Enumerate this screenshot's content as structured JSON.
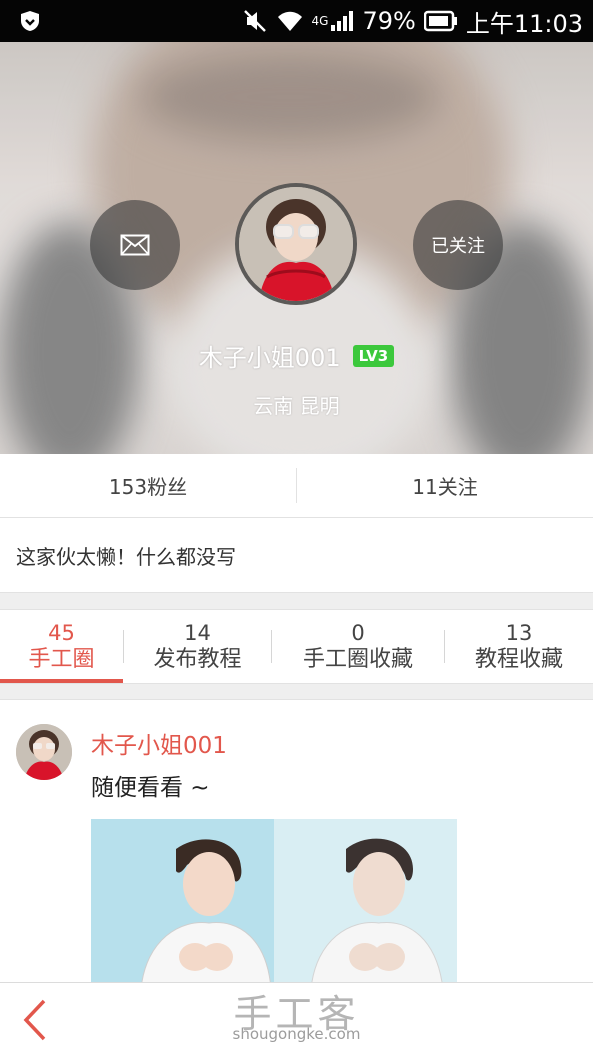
{
  "status_bar": {
    "battery_percent": "79%",
    "network": "4G",
    "time": "上午11:03"
  },
  "profile": {
    "username": "木子小姐001",
    "level_badge": "LV3",
    "location": "云南 昆明",
    "follow_label": "已关注",
    "message_icon": "envelope-icon"
  },
  "stats": {
    "fans": "153粉丝",
    "following": "11关注"
  },
  "bio": "这家伙太懒！什么都没写",
  "tabs": [
    {
      "count": "45",
      "label": "手工圈",
      "active": true
    },
    {
      "count": "14",
      "label": "发布教程",
      "active": false
    },
    {
      "count": "0",
      "label": "手工圈收藏",
      "active": false
    },
    {
      "count": "13",
      "label": "教程收藏",
      "active": false
    }
  ],
  "post": {
    "author": "木子小姐001",
    "text": "随便看看 ~"
  },
  "bottom_bar": {
    "watermark_cn": "手工客",
    "watermark_en": "shougongke.com"
  },
  "colors": {
    "accent": "#e2574c",
    "level_badge": "#3cc83c",
    "status_bar": "#050505"
  }
}
